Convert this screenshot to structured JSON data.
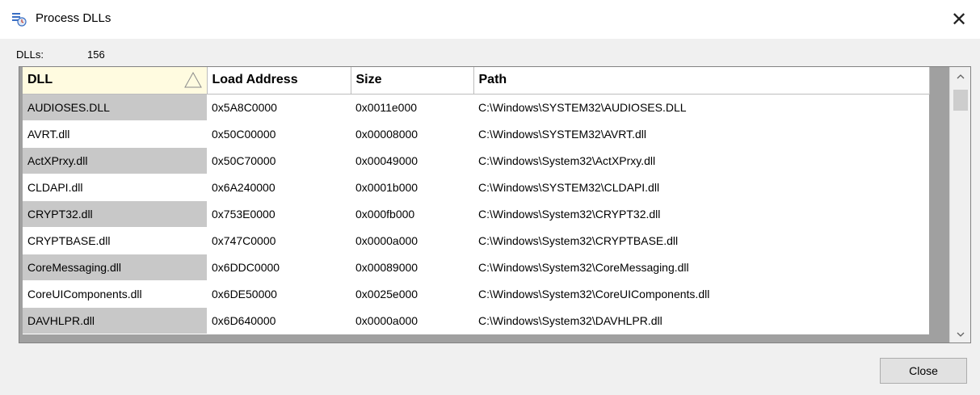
{
  "window": {
    "title": "Process DLLs",
    "close_glyph": "✕"
  },
  "summary": {
    "label": "DLLs:",
    "count": "156"
  },
  "table": {
    "columns": [
      "DLL",
      "Load Address",
      "Size",
      "Path"
    ],
    "sorted_column": "DLL",
    "sort_direction": "ascending",
    "rows": [
      {
        "dll": "AUDIOSES.DLL",
        "load_address": "0x5A8C0000",
        "size": "0x0011e000",
        "path": "C:\\Windows\\SYSTEM32\\AUDIOSES.DLL"
      },
      {
        "dll": "AVRT.dll",
        "load_address": "0x50C00000",
        "size": "0x00008000",
        "path": "C:\\Windows\\SYSTEM32\\AVRT.dll"
      },
      {
        "dll": "ActXPrxy.dll",
        "load_address": "0x50C70000",
        "size": "0x00049000",
        "path": "C:\\Windows\\System32\\ActXPrxy.dll"
      },
      {
        "dll": "CLDAPI.dll",
        "load_address": "0x6A240000",
        "size": "0x0001b000",
        "path": "C:\\Windows\\SYSTEM32\\CLDAPI.dll"
      },
      {
        "dll": "CRYPT32.dll",
        "load_address": "0x753E0000",
        "size": "0x000fb000",
        "path": "C:\\Windows\\System32\\CRYPT32.dll"
      },
      {
        "dll": "CRYPTBASE.dll",
        "load_address": "0x747C0000",
        "size": "0x0000a000",
        "path": "C:\\Windows\\System32\\CRYPTBASE.dll"
      },
      {
        "dll": "CoreMessaging.dll",
        "load_address": "0x6DDC0000",
        "size": "0x00089000",
        "path": "C:\\Windows\\System32\\CoreMessaging.dll"
      },
      {
        "dll": "CoreUIComponents.dll",
        "load_address": "0x6DE50000",
        "size": "0x0025e000",
        "path": "C:\\Windows\\System32\\CoreUIComponents.dll"
      },
      {
        "dll": "DAVHLPR.dll",
        "load_address": "0x6D640000",
        "size": "0x0000a000",
        "path": "C:\\Windows\\System32\\DAVHLPR.dll"
      }
    ]
  },
  "buttons": {
    "close_label": "Close"
  },
  "colors": {
    "grid_background": "#a0a0a0",
    "alt_row_key": "#c8c8c8",
    "sorted_header": "#fffbe0"
  },
  "icons": [
    "process-dlls-icon",
    "close-icon",
    "sort-ascending-icon",
    "scroll-up-icon",
    "scroll-down-icon"
  ]
}
